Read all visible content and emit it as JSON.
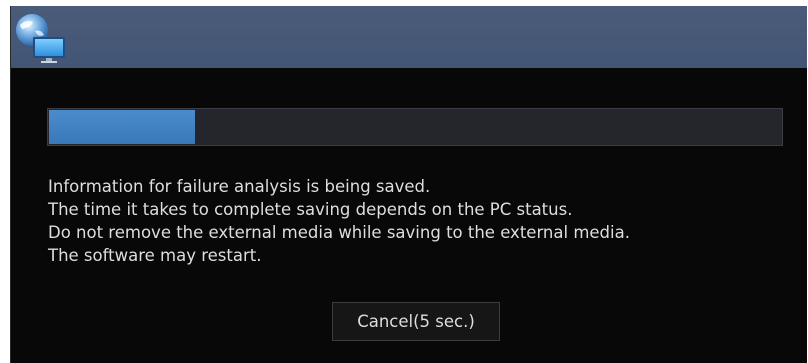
{
  "title_bar": {
    "icon": "globe-monitor-icon",
    "color": "#4a5c7a"
  },
  "progress": {
    "value_percent": 20,
    "fill_color": "#3f82c4",
    "track_color": "#24262b"
  },
  "message": {
    "lines": [
      "Information for failure analysis is being saved.",
      "The time it takes to complete saving depends on the PC status.",
      "Do not remove the external media while saving to the external media.",
      "The software may restart."
    ]
  },
  "buttons": {
    "cancel_label": "Cancel(5 sec.)"
  },
  "colors": {
    "dialog_background": "#080808",
    "text": "#dedede"
  }
}
